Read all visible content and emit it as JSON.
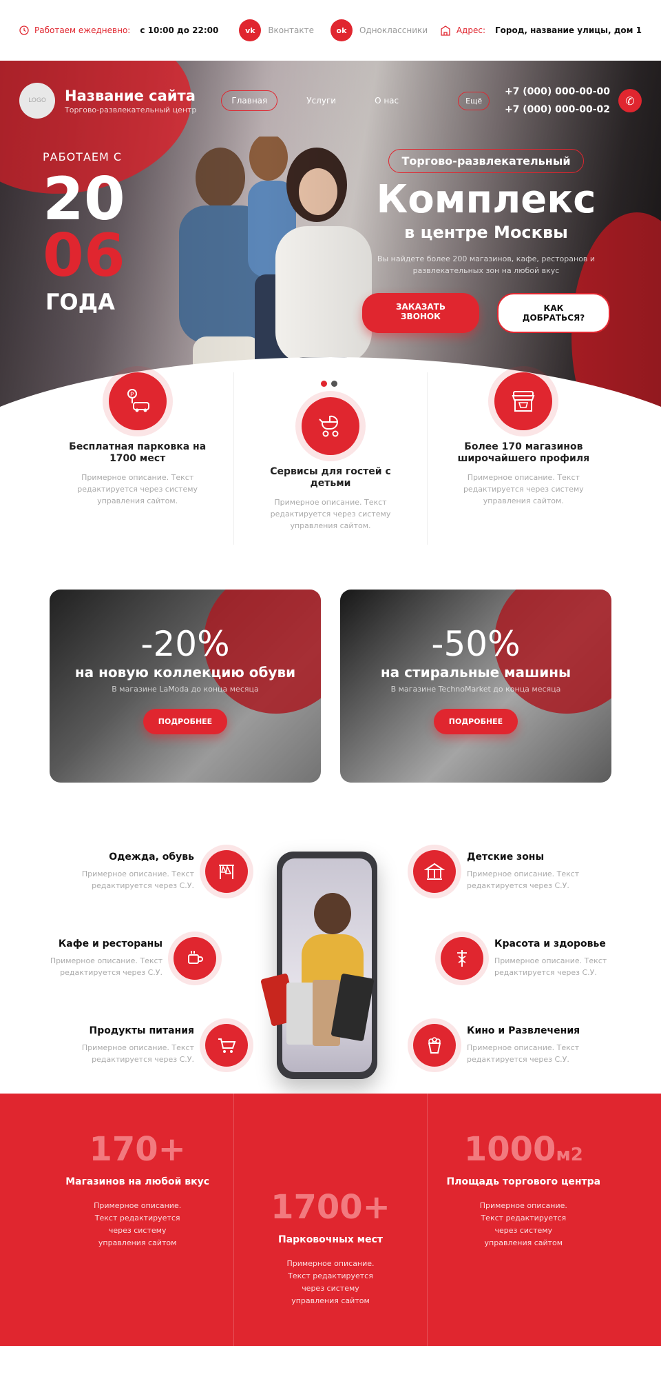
{
  "topbar": {
    "hours_label": "Работаем ежедневно:",
    "hours_value": "с 10:00 до 22:00",
    "vk_icon": "vk-icon",
    "vk_label": "Вконтакте",
    "ok_icon": "odnoklassniki-icon",
    "ok_label": "Одноклассники",
    "address_label": "Адрес:",
    "address_value": "Город, название улицы, дом 1"
  },
  "header": {
    "logo": "LOGO",
    "site_name": "Название сайта",
    "site_sub": "Торгово-развлекательный центр",
    "menu": [
      "Главная",
      "Услуги",
      "О нас"
    ],
    "more": "Ещё",
    "phones": [
      "+7 (000) 000-00-00",
      "+7 (000) 000-00-02"
    ]
  },
  "hero": {
    "since_label": "РАБОТАЕМ С",
    "year_a": "20",
    "year_b": "06",
    "year_suffix": "ГОДА",
    "tag": "Торгово-развлекательный",
    "title": "Комплекс",
    "subtitle": "в центре Москвы",
    "desc": "Вы найдете более 200 магазинов, кафе, ресторанов и развлекательных зон на любой вкус",
    "btn_call": "ЗАКАЗАТЬ ЗВОНОК",
    "btn_route": "КАК ДОБРАТЬСЯ?",
    "slides": 2,
    "active_slide": 1
  },
  "features": [
    {
      "icon": "parking-icon",
      "title": "Бесплатная парковка на 1700 мест",
      "desc": "Примерное описание. Текст редактируется через систему управления сайтом."
    },
    {
      "icon": "stroller-icon",
      "title": "Сервисы для гостей с детьми",
      "desc": "Примерное описание. Текст редактируется через систему управления сайтом."
    },
    {
      "icon": "shop-icon",
      "title": "Более 170 магазинов широчайшего профиля",
      "desc": "Примерное описание. Текст редактируется через систему управления сайтом."
    }
  ],
  "banners": [
    {
      "pct": "-20%",
      "title": "на новую коллекцию обуви",
      "sub": "В магазине LaModa до конца месяца",
      "btn": "ПОДРОБНЕЕ"
    },
    {
      "pct": "-50%",
      "title": "на стиральные машины",
      "sub": "В магазине TechnoMarket до конца месяца",
      "btn": "ПОДРОБНЕЕ"
    }
  ],
  "categories": [
    {
      "icon": "clothes-rack-icon",
      "title": "Одежда, обувь",
      "desc": "Примерное описание. Текст редактируется через С.У."
    },
    {
      "icon": "kids-carousel-icon",
      "title": "Детские зоны",
      "desc": "Примерное описание. Текст редактируется через С.У."
    },
    {
      "icon": "coffee-cup-icon",
      "title": "Кафе и рестораны",
      "desc": "Примерное описание. Текст редактируется через С.У."
    },
    {
      "icon": "caduceus-icon",
      "title": "Красота и здоровье",
      "desc": "Примерное описание. Текст редактируется через С.У."
    },
    {
      "icon": "shopping-cart-icon",
      "title": "Продукты питания",
      "desc": "Примерное описание. Текст редактируется через С.У."
    },
    {
      "icon": "popcorn-icon",
      "title": "Кино и Развлечения",
      "desc": "Примерное описание. Текст редактируется через С.У."
    }
  ],
  "stats": [
    {
      "num": "170+",
      "unit": "",
      "label": "Магазинов на любой вкус",
      "desc": "Примерное описание. Текст редактируется через систему управления сайтом"
    },
    {
      "num": "1700+",
      "unit": "",
      "label": "Парковочных мест",
      "desc": "Примерное описание. Текст редактируется через систему управления сайтом"
    },
    {
      "num": "1000",
      "unit": "м2",
      "label": "Площадь торгового центра",
      "desc": "Примерное описание. Текст редактируется через систему управления сайтом"
    }
  ],
  "colors": {
    "accent": "#e0262f",
    "muted": "#aaaaaa"
  }
}
